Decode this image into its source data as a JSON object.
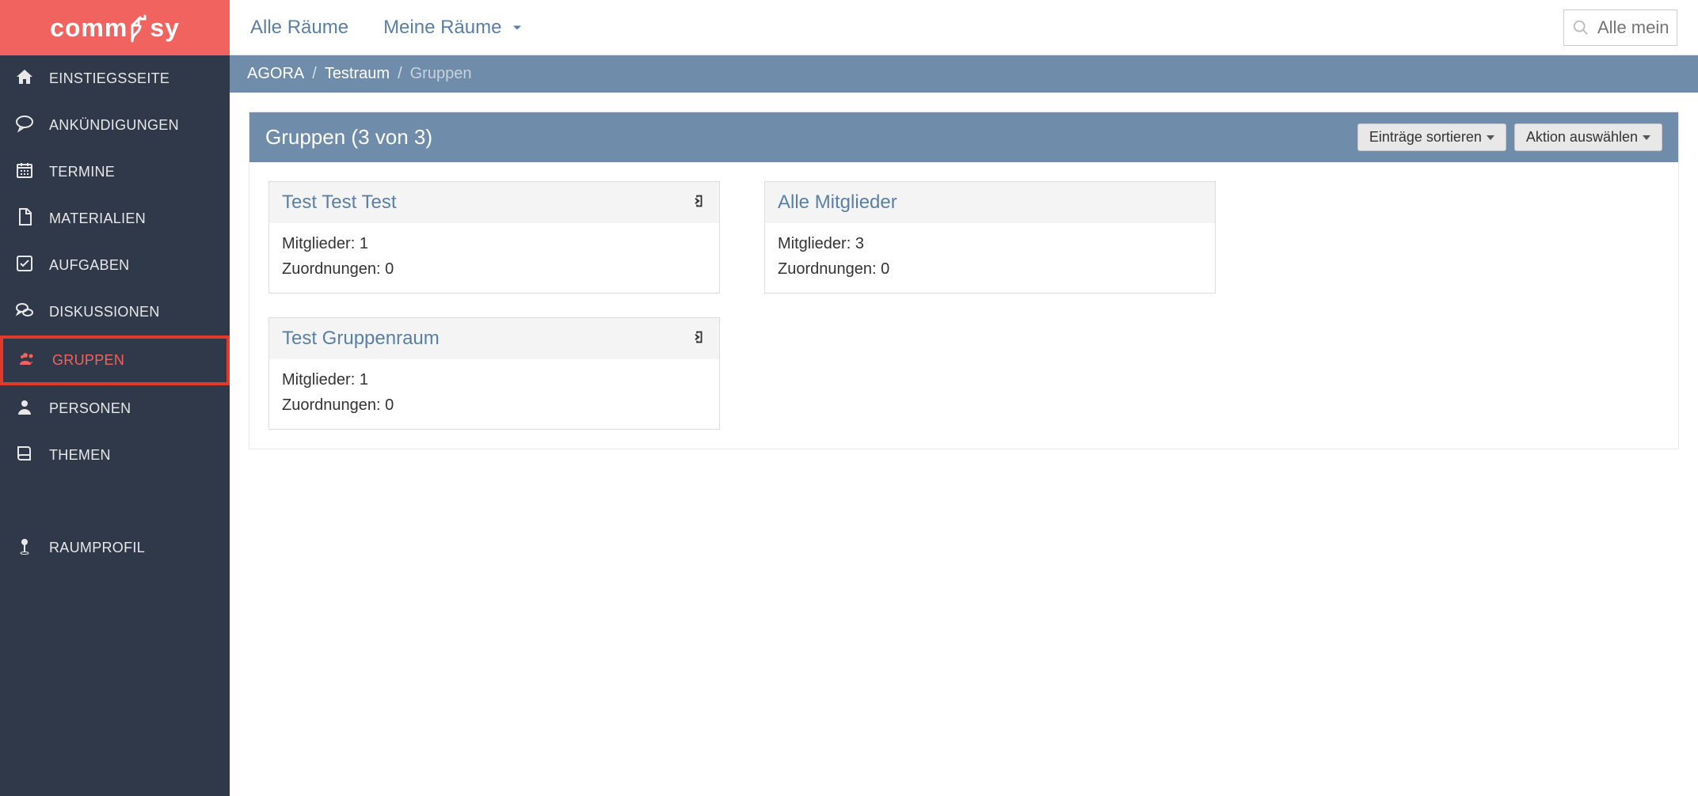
{
  "brand": "comm5sy",
  "sidebar": {
    "items": [
      {
        "label": "EINSTIEGSSEITE",
        "icon": "home",
        "active": false
      },
      {
        "label": "ANKÜNDIGUNGEN",
        "icon": "speech",
        "active": false
      },
      {
        "label": "TERMINE",
        "icon": "calendar",
        "active": false
      },
      {
        "label": "MATERIALIEN",
        "icon": "file",
        "active": false
      },
      {
        "label": "AUFGABEN",
        "icon": "check",
        "active": false
      },
      {
        "label": "DISKUSSIONEN",
        "icon": "comments",
        "active": false
      },
      {
        "label": "GRUPPEN",
        "icon": "users",
        "active": true
      },
      {
        "label": "PERSONEN",
        "icon": "user",
        "active": false
      },
      {
        "label": "THEMEN",
        "icon": "book",
        "active": false
      }
    ],
    "bottom": [
      {
        "label": "RAUMPROFIL",
        "icon": "pin"
      }
    ]
  },
  "topbar": {
    "all_rooms": "Alle Räume",
    "my_rooms": "Meine Räume",
    "search_placeholder": "Alle mein"
  },
  "breadcrumb": {
    "root": "AGORA",
    "room": "Testraum",
    "current": "Gruppen"
  },
  "panel": {
    "title": "Gruppen (3 von 3)",
    "sort_label": "Einträge sortieren",
    "action_label": "Aktion auswählen"
  },
  "labels": {
    "members": "Mitglieder:",
    "assignments": "Zuordnungen:"
  },
  "groups_left": [
    {
      "title": "Test Test Test",
      "members": "1",
      "assignments": "0",
      "has_enter": true
    },
    {
      "title": "Test Gruppenraum",
      "members": "1",
      "assignments": "0",
      "has_enter": true
    }
  ],
  "groups_right": [
    {
      "title": "Alle Mitglieder",
      "members": "3",
      "assignments": "0",
      "has_enter": false
    }
  ]
}
